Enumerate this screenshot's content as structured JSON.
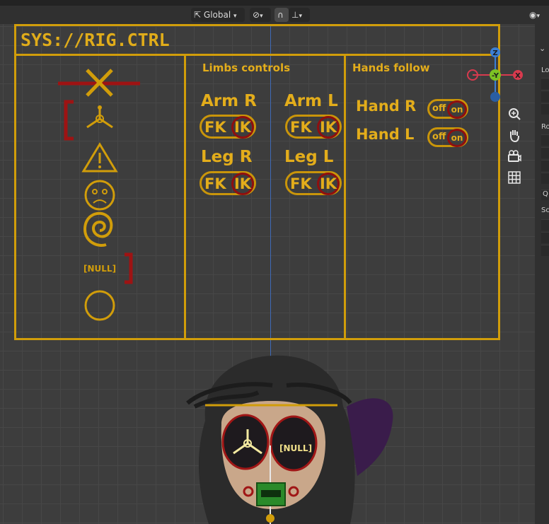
{
  "header": {
    "orientation": "Global",
    "orientation_icon": "transform-orientation-icon",
    "pivot_icon": "link-icon",
    "snap_icon": "magnet-icon",
    "snap_target_icon": "snap-increment-icon",
    "visibility_icon": "eye-icon"
  },
  "rig_panel": {
    "title": "SYS://RIG.CTRL",
    "sections": {
      "limbs_title": "Limbs controls",
      "hands_title": "Hands follow"
    },
    "icons": [
      "cross-icon",
      "trinode-icon",
      "warning-icon",
      "sad-face-icon",
      "spiral-icon",
      "null-icon",
      "circle-icon"
    ],
    "null_label": "[NULL]",
    "limbs": [
      {
        "name": "Arm R",
        "fk": "FK",
        "ik": "IK"
      },
      {
        "name": "Arm L",
        "fk": "FK",
        "ik": "IK"
      },
      {
        "name": "Leg R",
        "fk": "FK",
        "ik": "IK"
      },
      {
        "name": "Leg L",
        "fk": "FK",
        "ik": "IK"
      }
    ],
    "hands": [
      {
        "name": "Hand R",
        "off": "off",
        "on": "on"
      },
      {
        "name": "Hand L",
        "off": "off",
        "on": "on"
      }
    ]
  },
  "gizmo": {
    "z": "Z",
    "y": "-Y",
    "x": "X"
  },
  "nav": [
    "zoom-icon",
    "pan-hand-icon",
    "camera-icon",
    "grid-icon"
  ],
  "n_panel": {
    "labels": [
      "Lo",
      "Ro",
      "Sc"
    ],
    "letter": "Q"
  },
  "character": {
    "eye_label": "[NULL]"
  },
  "colors": {
    "accent": "#d19d0a",
    "ik_ring": "#8f0f0f",
    "axis_x": "#d83a4e",
    "axis_y": "#7dc224",
    "axis_z": "#3b7fd5",
    "bow": "#3a1c4b"
  }
}
